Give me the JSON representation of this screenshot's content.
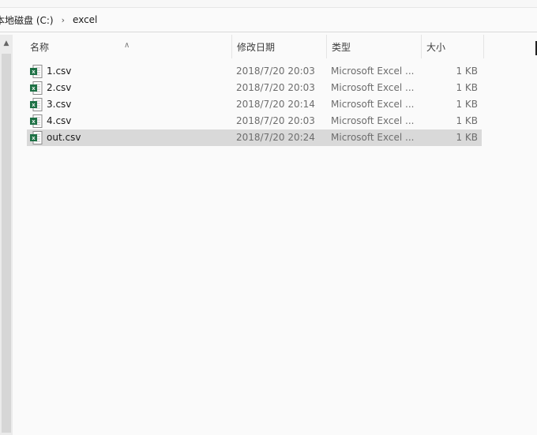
{
  "address": {
    "root": "本地磁盘 (C:)",
    "folder": "excel"
  },
  "columns": {
    "name": "名称",
    "date": "修改日期",
    "type": "类型",
    "size": "大小"
  },
  "files": [
    {
      "name": "1.csv",
      "date": "2018/7/20 20:03",
      "type": "Microsoft Excel ...",
      "size": "1 KB",
      "icon": "excel-csv-icon"
    },
    {
      "name": "2.csv",
      "date": "2018/7/20 20:03",
      "type": "Microsoft Excel ...",
      "size": "1 KB",
      "icon": "excel-csv-icon"
    },
    {
      "name": "3.csv",
      "date": "2018/7/20 20:14",
      "type": "Microsoft Excel ...",
      "size": "1 KB",
      "icon": "excel-csv-icon"
    },
    {
      "name": "4.csv",
      "date": "2018/7/20 20:03",
      "type": "Microsoft Excel ...",
      "size": "1 KB",
      "icon": "excel-csv-icon"
    },
    {
      "name": "out.csv",
      "date": "2018/7/20 20:24",
      "type": "Microsoft Excel ...",
      "size": "1 KB",
      "icon": "excel-csv-icon",
      "selected": true
    }
  ],
  "colors": {
    "selected_row": "#d9d9d9",
    "excel_green": "#1e7145"
  }
}
